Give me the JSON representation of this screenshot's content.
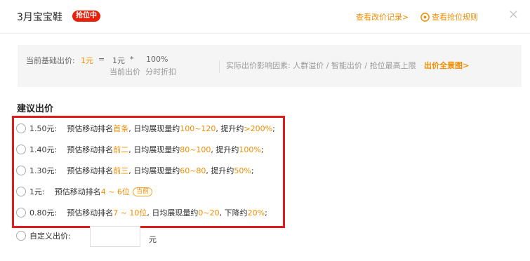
{
  "header": {
    "title": "3月宝宝鞋",
    "badge": "抢位中",
    "price_history_link": "查看改价记录>",
    "rules_link": "查看抢位规则",
    "close": "×"
  },
  "info_bar": {
    "base_label": "当前基础出价:",
    "base_value": "1元",
    "equals": "=",
    "current_price": "1元",
    "multiply": "*",
    "discount": "100%",
    "current_price_label": "当前出价",
    "discount_label": "分时折扣",
    "factors_text": "实际出价影响因素: 人群溢价 / 智能出价 / 抢位最高上限",
    "factors_link": "出价全景图>"
  },
  "suggest": {
    "title": "建议出价",
    "options": [
      {
        "price": "1.50元:",
        "t1": "预估移动排名",
        "rank": "首条",
        "t2": ", 日均展现量约",
        "imp": "100~120",
        "t3": ", 提升约",
        "change": ">200%",
        "t4": ";"
      },
      {
        "price": "1.40元:",
        "t1": "预估移动排名",
        "rank": "前二",
        "t2": ", 日均展现量约",
        "imp": "80~100",
        "t3": ", 提升约",
        "change": "100%",
        "t4": ";"
      },
      {
        "price": "1.30元:",
        "t1": "预估移动排名",
        "rank": "前三",
        "t2": ", 日均展现量约",
        "imp": "60~80",
        "t3": ", 提升约",
        "change": "50%",
        "t4": ";"
      },
      {
        "price": "1元:",
        "t1": "预估移动排名",
        "rank": "4 ~ 6位",
        "tag": "当前"
      },
      {
        "price": "0.80元:",
        "t1": "预估移动排名",
        "rank": "7 ~ 10位",
        "t2": ", 日均展现量约",
        "imp": "0~20",
        "t3": ", 下降约",
        "change": "20%",
        "t4": ";"
      }
    ],
    "custom_label": "自定义出价:",
    "custom_value": "",
    "unit": "元"
  },
  "colors": {
    "accent": "#f08c00",
    "badge": "#e8210a",
    "highlight_box": "#e01b1b"
  }
}
